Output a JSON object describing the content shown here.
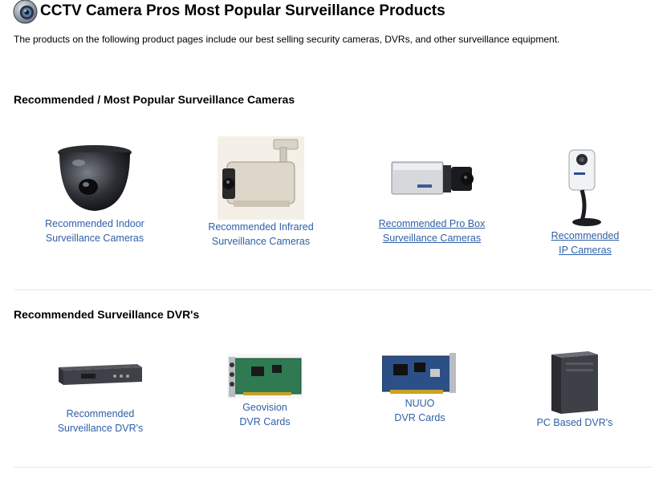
{
  "page": {
    "title": "CCTV Camera Pros Most Popular Surveillance Products",
    "intro": "The products on the following product pages include our best selling security cameras, DVRs, and other surveillance equipment."
  },
  "cameras": {
    "heading": "Recommended / Most Popular Surveillance Cameras",
    "items": [
      {
        "line1": "Recommended Indoor",
        "line2": "Surveillance Cameras"
      },
      {
        "line1": "Recommended Infrared",
        "line2": "Surveillance Cameras"
      },
      {
        "line1": "Recommended Pro Box",
        "line2": "Surveillance Cameras"
      },
      {
        "line1": "Recommended",
        "line2": "IP Cameras"
      }
    ]
  },
  "dvrs": {
    "heading": "Recommended Surveillance DVR's",
    "items": [
      {
        "line1": "Recommended",
        "line2": "Surveillance DVR's"
      },
      {
        "line1": "Geovision",
        "line2": "DVR Cards"
      },
      {
        "line1": "NUUO",
        "line2": "DVR Cards"
      },
      {
        "line1": "PC Based DVR's"
      }
    ]
  },
  "colors": {
    "link": "#2f5fa7",
    "divider": "#e8e8e8"
  }
}
